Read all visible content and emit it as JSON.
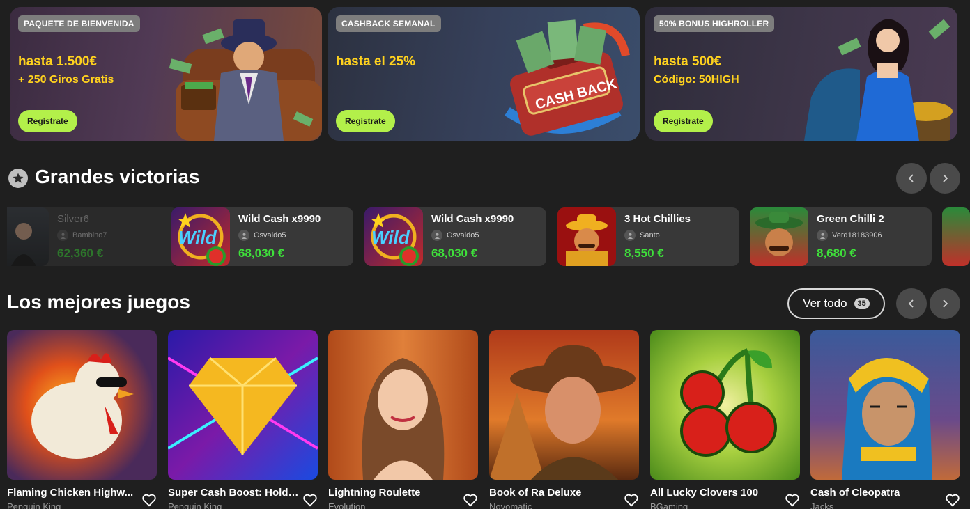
{
  "promos": [
    {
      "tag": "PAQUETE DE BIENVENIDA",
      "line1": "hasta 1.500€",
      "line2": "+ 250 Giros Gratis",
      "button": "Regístrate"
    },
    {
      "tag": "CASHBACK SEMANAL",
      "line1": "hasta el 25%",
      "line2": "",
      "button": "Regístrate"
    },
    {
      "tag": "50% BONUS HIGHROLLER",
      "line1": "hasta 500€",
      "line2": "Código: 50HIGH",
      "button": "Regístrate"
    }
  ],
  "wins_section": {
    "title": "Grandes victorias"
  },
  "wins": [
    {
      "game": "Silver6",
      "user": "Bambino7",
      "amount": "62,360 €"
    },
    {
      "game": "Wild Cash x9990",
      "user": "Osvaldo5",
      "amount": "68,030 €"
    },
    {
      "game": "Wild Cash x9990",
      "user": "Osvaldo5",
      "amount": "68,030 €"
    },
    {
      "game": "3 Hot Chillies",
      "user": "Santo",
      "amount": "8,550 €"
    },
    {
      "game": "Green Chilli 2",
      "user": "Verd18183906",
      "amount": "8,680 €"
    }
  ],
  "games_section": {
    "title": "Los mejores juegos",
    "view_all": "Ver todo",
    "count": "35"
  },
  "games": [
    {
      "title": "Flaming Chicken Highw...",
      "provider": "Penguin King"
    },
    {
      "title": "Super Cash Boost: Hold ...",
      "provider": "Penguin King"
    },
    {
      "title": "Lightning Roulette",
      "provider": "Evolution"
    },
    {
      "title": "Book of Ra Deluxe",
      "provider": "Novomatic"
    },
    {
      "title": "All Lucky Clovers 100",
      "provider": "BGaming"
    },
    {
      "title": "Cash of Cleopatra",
      "provider": "Jacks"
    }
  ],
  "colors": {
    "accent_green": "#b3f04a",
    "amount_green": "#3ee03a",
    "promo_yellow": "#ffd21e"
  }
}
